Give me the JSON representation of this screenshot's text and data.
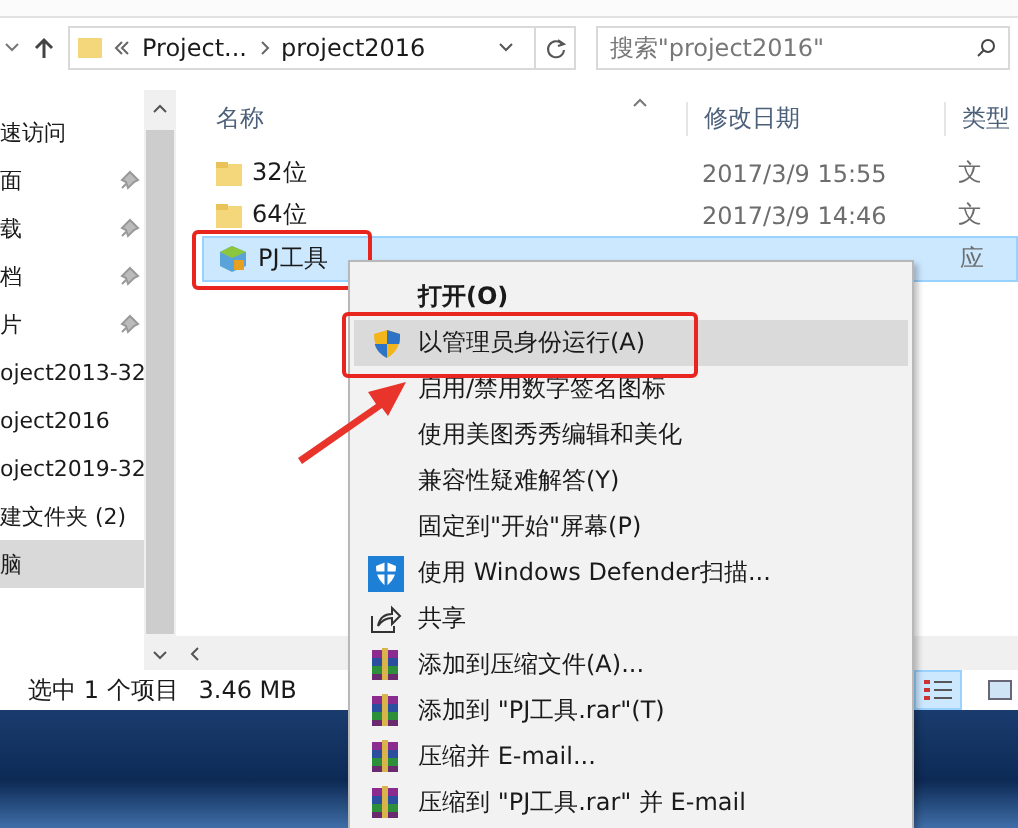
{
  "address": {
    "crumbs": [
      "Project...",
      "project2016"
    ]
  },
  "search": {
    "placeholder": "搜索\"project2016\""
  },
  "nav": [
    {
      "label": "速访问",
      "pinned": false,
      "selected": false
    },
    {
      "label": "面",
      "pinned": true,
      "selected": false
    },
    {
      "label": "载",
      "pinned": true,
      "selected": false
    },
    {
      "label": "档",
      "pinned": true,
      "selected": false
    },
    {
      "label": "片",
      "pinned": true,
      "selected": false
    },
    {
      "label": "oject2013-32",
      "pinned": false,
      "selected": false
    },
    {
      "label": "oject2016",
      "pinned": false,
      "selected": false
    },
    {
      "label": "oject2019-32",
      "pinned": false,
      "selected": false
    },
    {
      "label": "建文件夹 (2)",
      "pinned": false,
      "selected": false
    },
    {
      "label": "脑",
      "pinned": false,
      "selected": true
    }
  ],
  "columns": [
    "名称",
    "修改日期",
    "类型"
  ],
  "files": [
    {
      "name": "32位",
      "kind": "folder",
      "date": "2017/3/9 15:55",
      "type": "文",
      "selected": false
    },
    {
      "name": "64位",
      "kind": "folder",
      "date": "2017/3/9 14:46",
      "type": "文",
      "selected": false
    },
    {
      "name": "PJ工具",
      "kind": "app",
      "type": "应",
      "selected": true
    }
  ],
  "status_bar": {
    "selection": "选中 1 个项目",
    "size": "3.46 MB"
  },
  "menu": [
    {
      "label": "打开(O)",
      "kind": "plain",
      "bold": true,
      "highlighted": false
    },
    {
      "label": "以管理员身份运行(A)",
      "kind": "admin",
      "bold": false,
      "highlighted": true
    },
    {
      "label": "启用/禁用数字签名图标",
      "kind": "plain",
      "bold": false,
      "highlighted": false
    },
    {
      "label": "使用美图秀秀编辑和美化",
      "kind": "plain",
      "bold": false,
      "highlighted": false
    },
    {
      "label": "兼容性疑难解答(Y)",
      "kind": "plain",
      "bold": false,
      "highlighted": false
    },
    {
      "label": "固定到\"开始\"屏幕(P)",
      "kind": "plain",
      "bold": false,
      "highlighted": false
    },
    {
      "label": "使用 Windows Defender扫描...",
      "kind": "scan",
      "bold": false,
      "highlighted": false
    },
    {
      "label": "共享",
      "kind": "share",
      "bold": false,
      "highlighted": false
    },
    {
      "label": "添加到压缩文件(A)...",
      "kind": "archive",
      "bold": false,
      "highlighted": false
    },
    {
      "label": "添加到 \"PJ工具.rar\"(T)",
      "kind": "archive",
      "bold": false,
      "highlighted": false
    },
    {
      "label": "压缩并 E-mail...",
      "kind": "archive",
      "bold": false,
      "highlighted": false
    },
    {
      "label": "压缩到 \"PJ工具.rar\" 并 E-mail",
      "kind": "archive",
      "bold": false,
      "highlighted": false
    }
  ]
}
